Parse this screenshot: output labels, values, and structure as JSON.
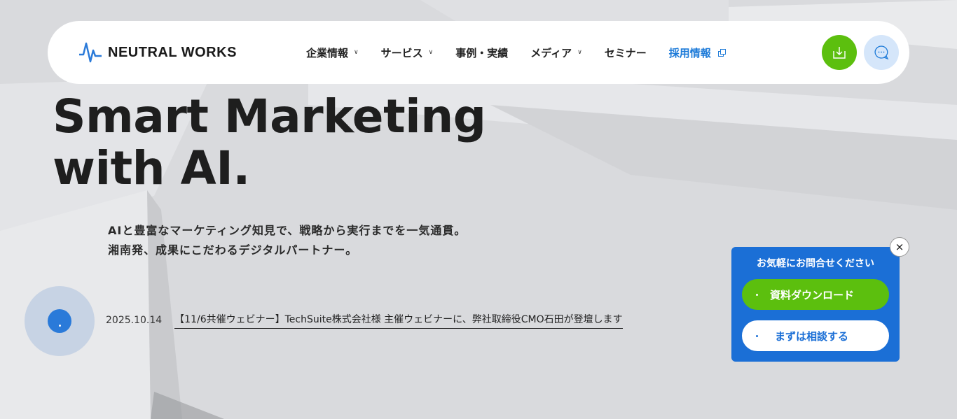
{
  "brand": {
    "name": "NEUTRAL WORKS",
    "accent": "#1c7ad8",
    "green": "#5cbf0e"
  },
  "nav": {
    "items": [
      {
        "label": "企業情報",
        "dropdown": true
      },
      {
        "label": "サービス",
        "dropdown": true
      },
      {
        "label": "事例・実績",
        "dropdown": false
      },
      {
        "label": "メディア",
        "dropdown": true
      },
      {
        "label": "セミナー",
        "dropdown": false
      },
      {
        "label": "採用情報",
        "external": true
      }
    ],
    "download_icon": "download-icon",
    "chat_icon": "chat-bubble-icon"
  },
  "hero": {
    "title_line1": "Smart Marketing",
    "title_line2": "with AI.",
    "sub_line1": "AIと豊富なマーケティング知見で、戦略から実行までを一気通貫。",
    "sub_line2": "湘南発、成果にこだわるデジタルパートナー。"
  },
  "news": {
    "date": "2025.10.14",
    "title": "【11/6共催ウェビナー】TechSuite株式会社様 主催ウェビナーに、弊社取締役CMO石田が登壇します"
  },
  "cta": {
    "title": "お気軽にお問合せください",
    "download_label": "資料ダウンロード",
    "consult_label": "まずは相談する",
    "close_label": "×"
  }
}
